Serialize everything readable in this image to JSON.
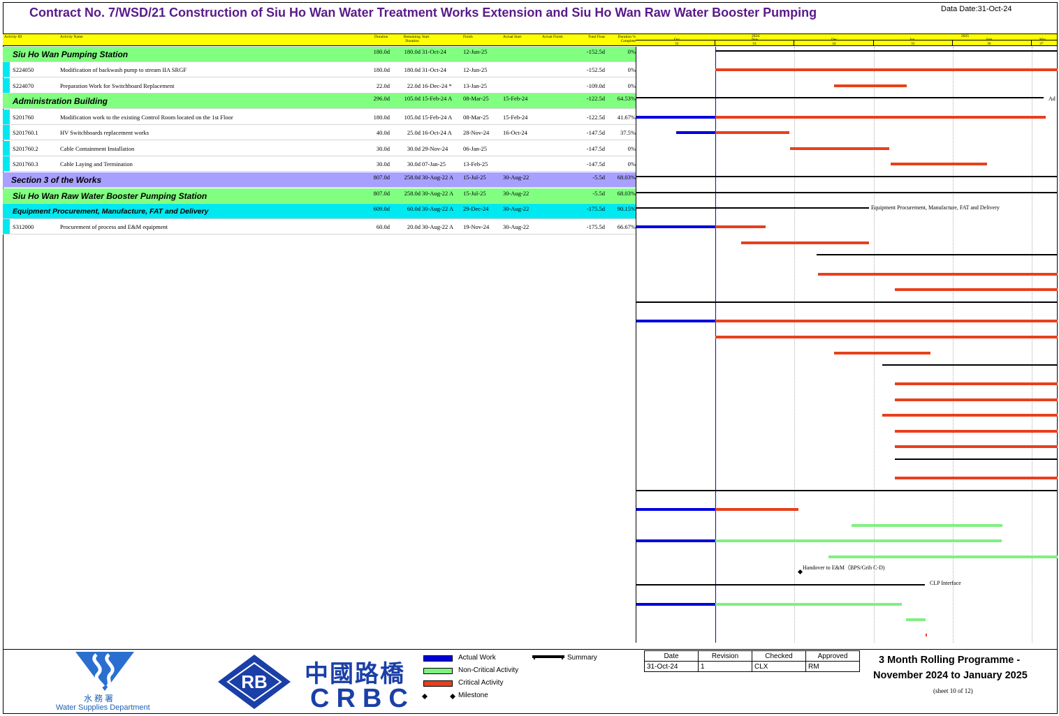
{
  "header": {
    "title": "Contract No. 7/WSD/21 Construction of Siu Ho Wan Water Treatment Works Extension and Siu Ho Wan Raw Water Booster Pumping",
    "data_date": "Data Date:31-Oct-24"
  },
  "columns": {
    "id": "Activity ID",
    "name": "Activity Name",
    "duration": "Duration",
    "remaining": "Remaining Duration",
    "start": "Start",
    "finish": "Finish",
    "actual_start": "Actual Start",
    "actual_finish": "Actual Finish",
    "total_float": "Total Float",
    "pct": "Duration % Complete"
  },
  "timescale": {
    "years": [
      "2024",
      "2025"
    ],
    "months": [
      "Oct",
      "Nov",
      "Dec",
      "Jan",
      "Feb",
      "Mar"
    ],
    "periods": [
      "32",
      "33",
      "34",
      "35",
      "36",
      "37"
    ]
  },
  "rows": [
    {
      "type": "group",
      "level": 1,
      "color": "green",
      "name": "Siu Ho Wan Pumping Station",
      "dur": "180.0d",
      "rem": "180.0d",
      "start": "31-Oct-24",
      "finish": "12-Jun-25",
      "astart": "",
      "tf": "-152.5d",
      "pct": "0%"
    },
    {
      "type": "task",
      "id": "S224050",
      "name": "Modification of backwash pump to stream IIA SRGF",
      "dur": "180.0d",
      "rem": "180.0d",
      "start": "31-Oct-24",
      "finish": "12-Jun-25",
      "astart": "",
      "tf": "-152.5d",
      "pct": "0%"
    },
    {
      "type": "task",
      "id": "S224070",
      "name": "Preparation Work for Switchboard Replacement",
      "dur": "22.0d",
      "rem": "22.0d",
      "start": "16-Dec-24 *",
      "finish": "13-Jan-25",
      "astart": "",
      "tf": "-109.0d",
      "pct": "0%"
    },
    {
      "type": "group",
      "level": 1,
      "color": "green",
      "name": "Administration Building",
      "dur": "296.0d",
      "rem": "105.0d",
      "start": "15-Feb-24 A",
      "finish": "08-Mar-25",
      "astart": "15-Feb-24",
      "tf": "-122.5d",
      "pct": "64.53%"
    },
    {
      "type": "task",
      "id": "S201760",
      "name": "Modification work to the existing Control Room located on the 1st Floor",
      "dur": "180.0d",
      "rem": "105.0d",
      "start": "15-Feb-24 A",
      "finish": "08-Mar-25",
      "astart": "15-Feb-24",
      "tf": "-122.5d",
      "pct": "41.67%"
    },
    {
      "type": "task",
      "id": "S201760.1",
      "name": "HV Switchboards replacement works",
      "dur": "40.0d",
      "rem": "25.0d",
      "start": "16-Oct-24 A",
      "finish": "28-Nov-24",
      "astart": "16-Oct-24",
      "tf": "-147.5d",
      "pct": "37.5%"
    },
    {
      "type": "task",
      "id": "S201760.2",
      "name": "Cable Containment Installation",
      "dur": "30.0d",
      "rem": "30.0d",
      "start": "29-Nov-24",
      "finish": "06-Jan-25",
      "astart": "",
      "tf": "-147.5d",
      "pct": "0%"
    },
    {
      "type": "task",
      "id": "S201760.3",
      "name": "Cable Laying and Termination",
      "dur": "30.0d",
      "rem": "30.0d",
      "start": "07-Jan-25",
      "finish": "13-Feb-25",
      "astart": "",
      "tf": "-147.5d",
      "pct": "0%"
    },
    {
      "type": "group",
      "level": 0,
      "color": "purple",
      "name": "Section 3 of the Works",
      "dur": "807.0d",
      "rem": "258.0d",
      "start": "30-Aug-22 A",
      "finish": "15-Jul-25",
      "astart": "30-Aug-22",
      "tf": "-5.5d",
      "pct": "68.03%"
    },
    {
      "type": "group",
      "level": 1,
      "color": "green",
      "name": "Siu Ho Wan Raw Water Booster Pumping Station",
      "dur": "807.0d",
      "rem": "258.0d",
      "start": "30-Aug-22 A",
      "finish": "15-Jul-25",
      "astart": "30-Aug-22",
      "tf": "-5.5d",
      "pct": "68.03%"
    },
    {
      "type": "group",
      "level": 2,
      "color": "cyan",
      "name": "Equipment Procurement, Manufacture, FAT and Delivery",
      "dur": "609.0d",
      "rem": "60.0d",
      "start": "30-Aug-22 A",
      "finish": "29-Dec-24",
      "astart": "30-Aug-22",
      "tf": "-175.5d",
      "pct": "90.15%"
    },
    {
      "type": "task",
      "id": "S312000",
      "name": "Procurement of process and E&M equipment",
      "dur": "60.0d",
      "rem": "20.0d",
      "start": "30-Aug-22 A",
      "finish": "19-Nov-24",
      "astart": "30-Aug-22",
      "tf": "-175.5d",
      "pct": "66.67%"
    }
  ],
  "gantt_labels": {
    "admin": "Ad",
    "equip": "Equipment Procurement, Manufacture, FAT and Delivery",
    "handover": "Handover to E&M（BPS/Grib C-D)",
    "clp": "CLP Interface"
  },
  "footer": {
    "wsd_cn": "水 務 署",
    "wsd_en": "Water Supplies Department",
    "rb_logo": "RB",
    "crbc_cn": "中國路橋",
    "crbc_en": "CRBC",
    "legend": {
      "actual": "Actual Work",
      "noncritical": "Non-Critical Activity",
      "critical": "Critical Activity",
      "milestone": "Milestone",
      "summary": "Summary"
    },
    "approval": {
      "h_date": "Date",
      "h_rev": "Revision",
      "h_chk": "Checked",
      "h_app": "Approved",
      "date": "31-Oct-24",
      "rev": "1",
      "chk": "CLX",
      "app": "RM"
    },
    "programme_line1": "3 Month Rolling Programme -",
    "programme_line2": "November 2024 to January 2025",
    "sheet": "(sheet 10 of 12)"
  },
  "colors": {
    "group_green": "#80ff80",
    "group_purple": "#a8a0ff",
    "group_cyan": "#00e8f0",
    "actual": "#0000dd",
    "critical": "#e8401c",
    "noncritical": "#80f080"
  }
}
